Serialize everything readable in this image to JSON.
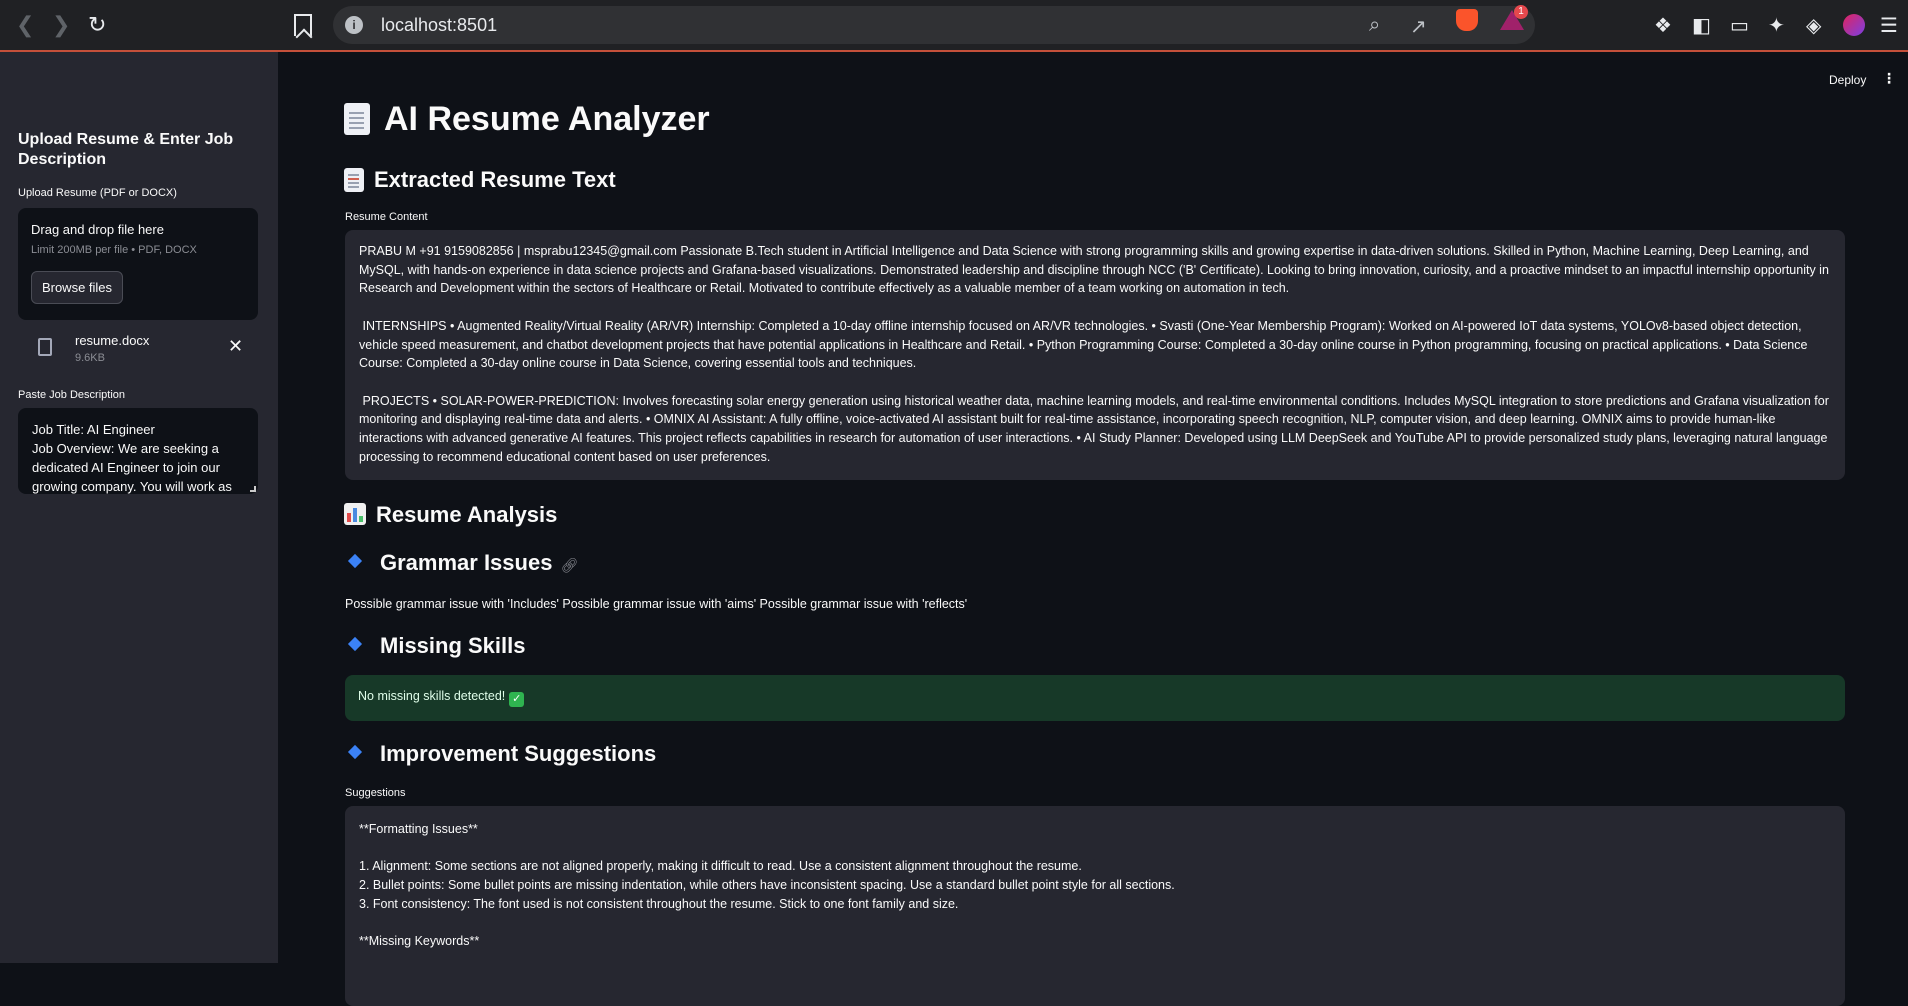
{
  "browser": {
    "url": "localhost:8501",
    "notification_count": "1"
  },
  "sidebar": {
    "title": "Upload Resume & Enter Job Description",
    "upload_label": "Upload Resume (PDF or DOCX)",
    "dropzone_title": "Drag and drop file here",
    "dropzone_limit": "Limit 200MB per file • PDF, DOCX",
    "browse_button": "Browse files",
    "file_name": "resume.docx",
    "file_size": "9.6KB",
    "jd_label": "Paste Job Description",
    "jd_text": "Job Title: AI Engineer\nJob Overview: We are seeking a dedicated AI Engineer to join our growing company. You will work as"
  },
  "header": {
    "deploy_label": "Deploy"
  },
  "main": {
    "title": "AI Resume Analyzer",
    "extracted_heading": "Extracted Resume Text",
    "resume_content_label": "Resume Content",
    "resume_paragraphs": [
      "PRABU M +91 9159082856 | msprabu12345@gmail.com Passionate B.Tech student in Artificial Intelligence and Data Science with strong programming skills and growing expertise in data-driven solutions. Skilled in Python, Machine Learning, Deep Learning, and MySQL, with hands-on experience in data science projects and Grafana-based visualizations. Demonstrated leadership and discipline through NCC ('B' Certificate). Looking to bring innovation, curiosity, and a proactive mindset to an impactful internship opportunity in Research and Development within the sectors of Healthcare or Retail. Motivated to contribute effectively as a valuable member of a team working on automation in tech.",
      " INTERNSHIPS • Augmented Reality/Virtual Reality (AR/VR) Internship: Completed a 10-day offline internship focused on AR/VR technologies. • Svasti (One-Year Membership Program): Worked on AI-powered IoT data systems, YOLOv8-based object detection, vehicle speed measurement, and chatbot development projects that have potential applications in Healthcare and Retail. • Python Programming Course: Completed a 30-day online course in Python programming, focusing on practical applications. • Data Science Course: Completed a 30-day online course in Data Science, covering essential tools and techniques.",
      " PROJECTS • SOLAR-POWER-PREDICTION: Involves forecasting solar energy generation using historical weather data, machine learning models, and real-time environmental conditions. Includes MySQL integration to store predictions and Grafana visualization for monitoring and displaying real-time data and alerts. • OMNIX AI Assistant: A fully offline, voice-activated AI assistant built for real-time assistance, incorporating speech recognition, NLP, computer vision, and deep learning. OMNIX aims to provide human-like interactions with advanced generative AI features. This project reflects capabilities in research for automation of user interactions. • AI Study Planner: Developed using LLM DeepSeek and YouTube API to provide personalized study plans, leveraging natural language processing to recommend educational content based on user preferences."
    ],
    "analysis_heading": "Resume Analysis",
    "grammar_heading": "Grammar Issues",
    "grammar_text": "Possible grammar issue with 'Includes' Possible grammar issue with 'aims' Possible grammar issue with 'reflects'",
    "missing_heading": "Missing Skills",
    "missing_text": "No missing skills detected!",
    "improve_heading": "Improvement Suggestions",
    "suggestions_label": "Suggestions",
    "suggestion_lines": [
      "**Formatting Issues**",
      "",
      "1. Alignment: Some sections are not aligned properly, making it difficult to read. Use a consistent alignment throughout the resume.",
      "2. Bullet points: Some bullet points are missing indentation, while others have inconsistent spacing. Use a standard bullet point style for all sections.",
      "3. Font consistency: The font used is not consistent throughout the resume. Stick to one font family and size.",
      "",
      "**Missing Keywords**"
    ]
  },
  "colors": {
    "accent_blue": "#3b82f6",
    "success_bg": "#173928",
    "panel_bg": "#262730",
    "app_bg": "#0e1117"
  }
}
